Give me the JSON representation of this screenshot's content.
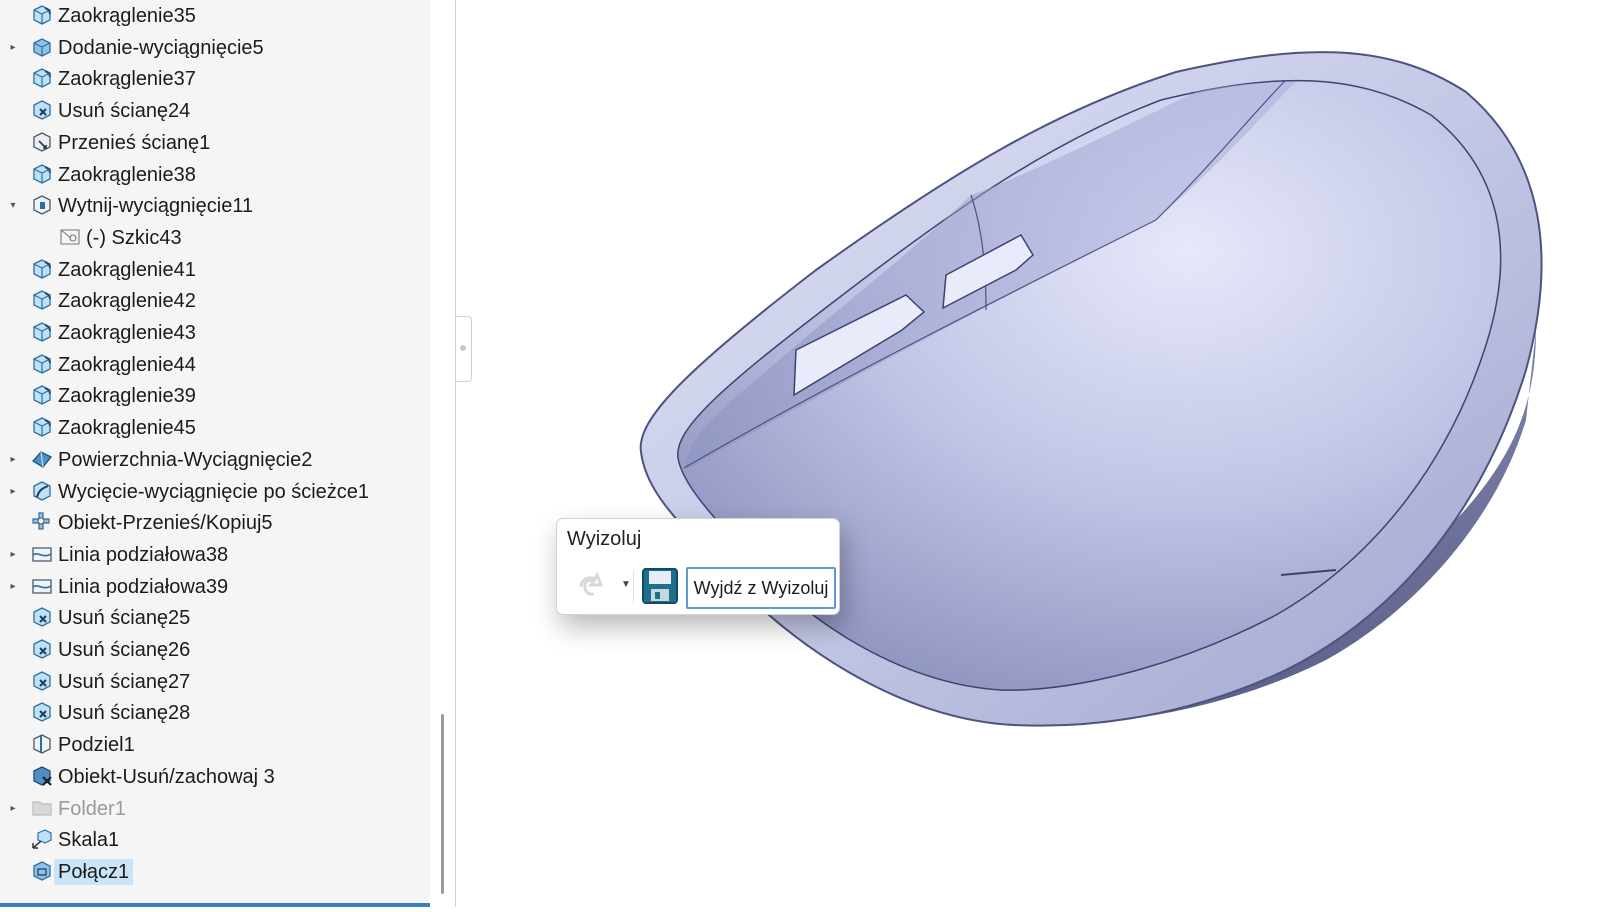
{
  "tree": {
    "items": [
      {
        "label": "Zaokrąglenie35",
        "icon": "fillet-feature-icon",
        "expand": ""
      },
      {
        "label": "Dodanie-wyciągnięcie5",
        "icon": "boss-extrude-icon",
        "expand": "collapsed"
      },
      {
        "label": "Zaokrąglenie37",
        "icon": "fillet-feature-icon",
        "expand": ""
      },
      {
        "label": "Usuń ścianę24",
        "icon": "delete-face-icon",
        "expand": ""
      },
      {
        "label": "Przenieś ścianę1",
        "icon": "move-face-icon",
        "expand": ""
      },
      {
        "label": "Zaokrąglenie38",
        "icon": "fillet-feature-icon",
        "expand": ""
      },
      {
        "label": "Wytnij-wyciągnięcie11",
        "icon": "cut-extrude-icon",
        "expand": "expanded"
      },
      {
        "label": "(-) Szkic43",
        "icon": "sketch-icon",
        "expand": "",
        "indent": 1
      },
      {
        "label": "Zaokrąglenie41",
        "icon": "fillet-feature-icon",
        "expand": ""
      },
      {
        "label": "Zaokrąglenie42",
        "icon": "fillet-feature-icon",
        "expand": ""
      },
      {
        "label": "Zaokrąglenie43",
        "icon": "fillet-feature-icon",
        "expand": ""
      },
      {
        "label": "Zaokrąglenie44",
        "icon": "fillet-feature-icon",
        "expand": ""
      },
      {
        "label": "Zaokrąglenie39",
        "icon": "fillet-feature-icon",
        "expand": ""
      },
      {
        "label": "Zaokrąglenie45",
        "icon": "fillet-feature-icon",
        "expand": ""
      },
      {
        "label": "Powierzchnia-Wyciągnięcie2",
        "icon": "surface-extrude-icon",
        "expand": "collapsed"
      },
      {
        "label": "Wycięcie-wyciągnięcie po ścieżce1",
        "icon": "swept-cut-icon",
        "expand": "collapsed"
      },
      {
        "label": "Obiekt-Przenieś/Kopiuj5",
        "icon": "move-copy-body-icon",
        "expand": ""
      },
      {
        "label": "Linia podziałowa38",
        "icon": "split-line-icon",
        "expand": "collapsed"
      },
      {
        "label": "Linia podziałowa39",
        "icon": "split-line-icon",
        "expand": "collapsed"
      },
      {
        "label": "Usuń ścianę25",
        "icon": "delete-face-icon",
        "expand": ""
      },
      {
        "label": "Usuń ścianę26",
        "icon": "delete-face-icon",
        "expand": ""
      },
      {
        "label": "Usuń ścianę27",
        "icon": "delete-face-icon",
        "expand": ""
      },
      {
        "label": "Usuń ścianę28",
        "icon": "delete-face-icon",
        "expand": ""
      },
      {
        "label": "Podziel1",
        "icon": "split-icon",
        "expand": ""
      },
      {
        "label": "Obiekt-Usuń/zachowaj 3",
        "icon": "delete-keep-body-icon",
        "expand": ""
      },
      {
        "label": "Folder1",
        "icon": "folder-icon",
        "expand": "collapsed",
        "dim": true
      },
      {
        "label": "Skala1",
        "icon": "scale-icon",
        "expand": ""
      },
      {
        "label": "Połącz1",
        "icon": "combine-icon",
        "expand": "",
        "selected": true
      }
    ]
  },
  "popup": {
    "title": "Wyizoluj",
    "undo_icon": "undo-icon",
    "save_icon": "save-icon",
    "exit_label": "Wyjdź z Wyizoluj"
  },
  "colors": {
    "selection": "#cce4f7",
    "accent": "#3c7fc1",
    "model": "#c9cde8"
  }
}
